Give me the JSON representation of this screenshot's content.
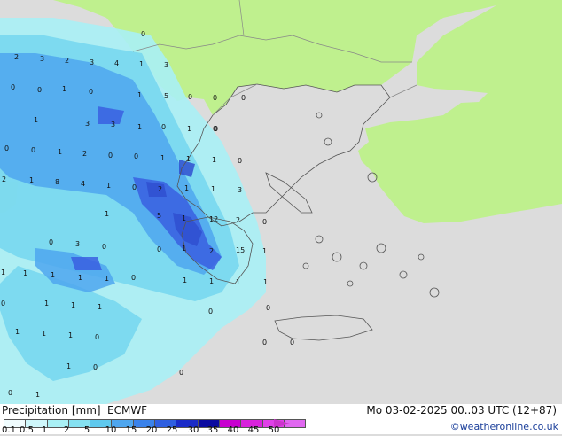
{
  "map": {
    "colors": {
      "sea": "#dcdcdc",
      "land": "#bff08e",
      "forecast_area": "#dcdcdc",
      "precip_light": "#a9f0f5",
      "precip_mid": "#74d6ee",
      "precip_heavy": "#4ea6ee",
      "precip_very_heavy": "#3a5fe0"
    },
    "point_values": [
      "2",
      "3",
      "2",
      "3",
      "4",
      "1",
      "3",
      "0",
      "1",
      "0",
      "0",
      "0",
      "0",
      "1",
      "5",
      "0",
      "0",
      "0",
      "1",
      "3",
      "3",
      "1",
      "0",
      "1",
      "0",
      "0",
      "1",
      "2",
      "0",
      "0",
      "1",
      "1",
      "1",
      "0",
      "2",
      "0",
      "1",
      "8",
      "4",
      "1",
      "0",
      "2",
      "1",
      "1",
      "3",
      "5",
      "1",
      "12",
      "2",
      "0",
      "1",
      "2",
      "15",
      "1",
      "0",
      "0",
      "1",
      "1",
      "1",
      "1",
      "1",
      "0",
      "3",
      "0",
      "1",
      "1",
      "1",
      "1",
      "0",
      "1",
      "1",
      "1",
      "1",
      "1",
      "1",
      "0",
      "0",
      "0",
      "1",
      "0",
      "0",
      "0",
      "1",
      "0",
      "1",
      "0"
    ]
  },
  "footer": {
    "title": "Precipitation [mm]",
    "model": "ECMWF",
    "valid_time": "Mo 03-02-2025 00..03 UTC (12+87)",
    "credit": "©weatheronline.co.uk",
    "scale_labels": [
      "0.1",
      "0.5",
      "1",
      "2",
      "5",
      "10",
      "15",
      "20",
      "25",
      "30",
      "35",
      "40",
      "45",
      "50"
    ],
    "scale_colors": [
      "#f0fcfe",
      "#cff7fb",
      "#a9f0f5",
      "#85e1f1",
      "#5fc9ee",
      "#4ea6ee",
      "#3a82ea",
      "#2f5fe0",
      "#1a2bc8",
      "#0a0aa0",
      "#c800d0",
      "#d822dc",
      "#e040e8",
      "#e068f0"
    ]
  }
}
